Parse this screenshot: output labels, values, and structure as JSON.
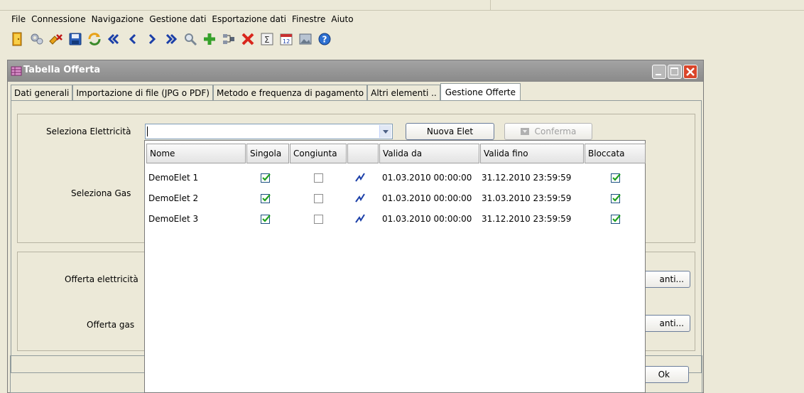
{
  "menu": [
    "File",
    "Connessione",
    "Navigazione",
    "Gestione dati",
    "Esportazione dati",
    "Finestre",
    "Aiuto"
  ],
  "toolbar_icons": [
    "exit-icon",
    "configure-icon",
    "delete-all-icon",
    "save-icon",
    "refresh-icon",
    "first-icon",
    "previous-icon",
    "next-icon",
    "last-icon",
    "search-icon",
    "add-icon",
    "merge-icon",
    "delete-icon",
    "sum-icon",
    "calendar-icon",
    "image-icon",
    "help-icon"
  ],
  "window": {
    "title": "Tabella Offerta",
    "tabs": [
      "Dati generali",
      "Importazione di file (JPG o PDF)",
      "Metodo e frequenza di pagamento",
      "Altri elementi ..",
      "Gestione Offerte"
    ],
    "active_tab": 4
  },
  "form": {
    "seleziona_elettricita_label": "Seleziona Elettricità",
    "elettricita_value": "",
    "nuova_elet_label": "Nuova Elet",
    "conferma_label": "Conferma",
    "seleziona_gas_label": "Seleziona Gas",
    "offerta_elettricita_label": "Offerta elettricità",
    "offerta_gas_label": "Offerta gas",
    "btn_partial_1": "anti...",
    "btn_partial_2": "anti...",
    "ok_label": "Ok"
  },
  "popup_table": {
    "columns": [
      "Nome",
      "Singola",
      "Congiunta",
      "",
      "Valida da",
      "Valida fino",
      "Bloccata"
    ],
    "rows": [
      {
        "nome": "DemoElet 1",
        "singola": true,
        "congiunta": false,
        "valida_da": "01.03.2010 00:00:00",
        "valida_fino": "31.12.2010 23:59:59",
        "bloccata": true
      },
      {
        "nome": "DemoElet 2",
        "singola": true,
        "congiunta": false,
        "valida_da": "01.03.2010 00:00:00",
        "valida_fino": "31.03.2010 23:59:59",
        "bloccata": true
      },
      {
        "nome": "DemoElet 3",
        "singola": true,
        "congiunta": false,
        "valida_da": "01.03.2010 00:00:00",
        "valida_fino": "31.12.2010 23:59:59",
        "bloccata": true
      }
    ]
  }
}
